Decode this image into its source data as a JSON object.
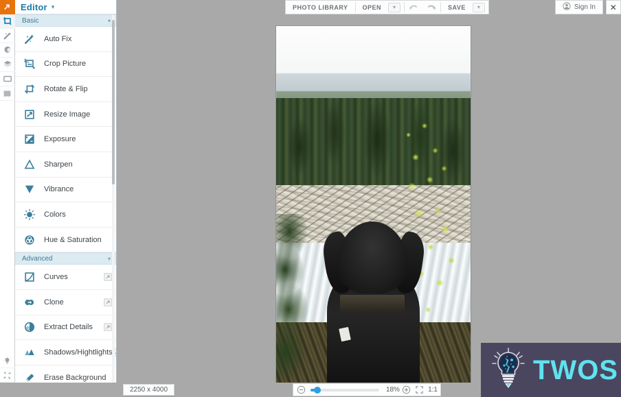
{
  "rail": {
    "logo_icon": "orange-arrow-logo-icon",
    "items": [
      {
        "name": "crop-tool",
        "icon": "crop-icon",
        "selected": true
      },
      {
        "name": "magic-wand-tool",
        "icon": "magic-wand-icon",
        "selected": false
      },
      {
        "name": "retouch-tool",
        "icon": "portrait-retouch-icon",
        "selected": false
      },
      {
        "name": "layers-tool",
        "icon": "layers-icon",
        "selected": false
      },
      {
        "name": "frames-tool",
        "icon": "frame-icon",
        "selected": false
      },
      {
        "name": "texture-tool",
        "icon": "texture-icon",
        "selected": false
      }
    ],
    "bottom_items": [
      {
        "name": "tips",
        "icon": "lightbulb-icon"
      },
      {
        "name": "fullscreen",
        "icon": "expand-arrows-icon"
      },
      {
        "name": "help",
        "icon": "question-mark-icon"
      }
    ]
  },
  "panel": {
    "title": "Editor",
    "title_caret": "▾",
    "groups": [
      {
        "label": "Basic",
        "caret": "▾",
        "items": [
          {
            "label": "Auto Fix",
            "icon": "magic-wand-icon",
            "badge": null
          },
          {
            "label": "Crop Picture",
            "icon": "crop-picture-icon",
            "badge": null
          },
          {
            "label": "Rotate & Flip",
            "icon": "rotate-flip-icon",
            "badge": null
          },
          {
            "label": "Resize Image",
            "icon": "resize-image-icon",
            "badge": null
          },
          {
            "label": "Exposure",
            "icon": "exposure-icon",
            "badge": null
          },
          {
            "label": "Sharpen",
            "icon": "sharpen-triangle-icon",
            "badge": null
          },
          {
            "label": "Vibrance",
            "icon": "vibrance-icon",
            "badge": null
          },
          {
            "label": "Colors",
            "icon": "colors-icon",
            "badge": null
          },
          {
            "label": "Hue & Saturation",
            "icon": "hue-saturation-icon",
            "badge": null
          }
        ]
      },
      {
        "label": "Advanced",
        "caret": "▾",
        "items": [
          {
            "label": "Curves",
            "icon": "curves-icon",
            "badge": "premium-badge-icon"
          },
          {
            "label": "Clone",
            "icon": "clone-icon",
            "badge": "premium-badge-icon"
          },
          {
            "label": "Extract Details",
            "icon": "extract-details-icon",
            "badge": "premium-badge-icon"
          },
          {
            "label": "Shadows/Hightlights",
            "icon": "shadows-highlights-icon",
            "badge": "premium-badge-icon"
          },
          {
            "label": "Erase Background",
            "icon": "eraser-icon",
            "badge": null
          }
        ]
      }
    ]
  },
  "toolbar": {
    "photo_library_label": "PHOTO LIBRARY",
    "open_label": "OPEN",
    "open_caret": "▾",
    "undo_icon": "undo-arrow-icon",
    "redo_icon": "redo-arrow-icon",
    "save_label": "SAVE",
    "save_caret": "▾",
    "sign_in_label": "Sign In",
    "sign_in_icon": "user-avatar-icon",
    "close_label": "✕"
  },
  "statusbar": {
    "dimensions": "2250 x 4000",
    "zoom_out_icon": "zoom-out-circle-icon",
    "zoom_in_icon": "zoom-in-circle-icon",
    "zoom_percent": "18%",
    "fit_icon": "fit-to-screen-icon",
    "actual_size_label": "1:1",
    "slider_value": 5
  },
  "watermark": {
    "text": "TWOS",
    "icon": "lightbulb-logo-icon",
    "background_color": "#4b4660",
    "text_color": "#5fe3ef"
  },
  "colors": {
    "accent_blue": "#1b7ba8",
    "group_header_bg": "#dceaf1",
    "canvas_bg": "#a9a9a9",
    "brand_orange": "#e8720c",
    "slider_blue": "#2f9fe0"
  },
  "photo": {
    "description": "black dog looking out over a river with driftwood logs, evergreen forest and mountains"
  }
}
